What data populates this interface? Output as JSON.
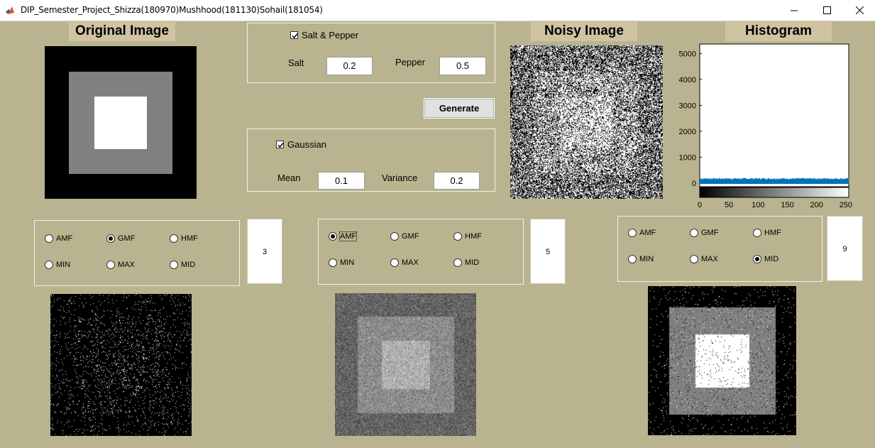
{
  "window": {
    "title": "DIP_Semester_Project_Shizza(180970)Mushhood(181130)Sohail(181054)"
  },
  "headers": {
    "original": "Original Image",
    "noisy": "Noisy Image",
    "histogram": "Histogram"
  },
  "salt_pepper": {
    "checkbox_label": "Salt & Pepper",
    "checked": true,
    "salt_label": "Salt",
    "salt_value": "0.2",
    "pepper_label": "Pepper",
    "pepper_value": "0.5"
  },
  "generate": {
    "label": "Generate"
  },
  "gaussian": {
    "checkbox_label": "Gaussian",
    "checked": true,
    "mean_label": "Mean",
    "mean_value": "0.1",
    "variance_label": "Variance",
    "variance_value": "0.2"
  },
  "filter_groups": [
    {
      "options": [
        "AMF",
        "GMF",
        "HMF",
        "MIN",
        "MAX",
        "MID"
      ],
      "selected": "GMF",
      "window_size": "3"
    },
    {
      "options": [
        "AMF",
        "GMF",
        "HMF",
        "MIN",
        "MAX",
        "MID"
      ],
      "selected": "AMF",
      "window_size": "5"
    },
    {
      "options": [
        "AMF",
        "GMF",
        "HMF",
        "MIN",
        "MAX",
        "MID"
      ],
      "selected": "MID",
      "window_size": "9"
    }
  ],
  "histogram": {
    "y_ticks": [
      "5000",
      "4000",
      "3000",
      "2000",
      "1000",
      "0"
    ],
    "x_ticks": [
      "0",
      "50",
      "100",
      "150",
      "200",
      "250"
    ],
    "bar_color": "#0072bd"
  },
  "chart_data": {
    "type": "bar",
    "title": "Histogram",
    "xlabel": "",
    "ylabel": "",
    "x_range": [
      0,
      255
    ],
    "y_range": [
      0,
      5500
    ],
    "approx_count_per_bin": 200,
    "note_level": "uniform low counts across all intensities"
  }
}
